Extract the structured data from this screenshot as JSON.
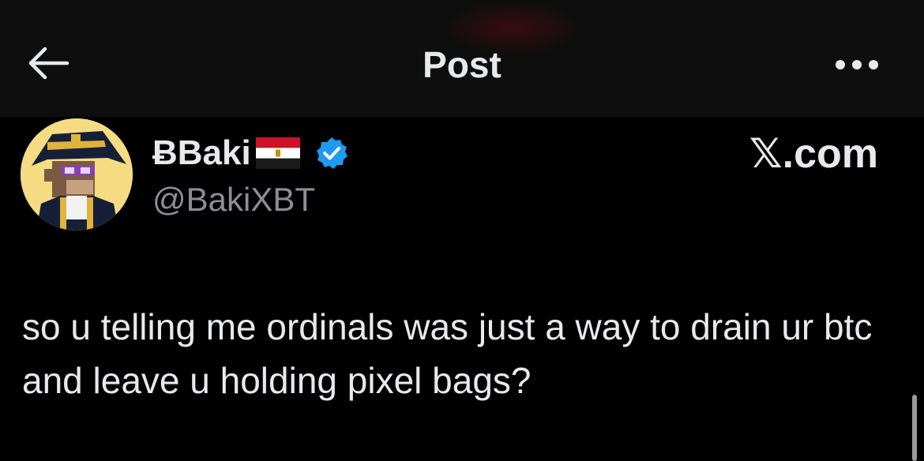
{
  "header": {
    "title": "Post",
    "back_icon": "arrow-left-icon",
    "more_icon": "more-horizontal-icon"
  },
  "post": {
    "author_name": "Baki",
    "author_name_prefix": "Ƀ",
    "author_flag": "egypt-flag-icon",
    "verified_icon": "verified-badge-icon",
    "handle": "@BakiXBT",
    "source": "𝕏.com",
    "text": "so u telling me ordinals was just a way to drain ur btc and leave u holding pixel bags?"
  },
  "colors": {
    "background": "#000000",
    "header_background": "#0e0e0e",
    "text": "#e7e9ea",
    "secondary_text": "#8b9096",
    "verified_blue": "#1d9bf0"
  }
}
